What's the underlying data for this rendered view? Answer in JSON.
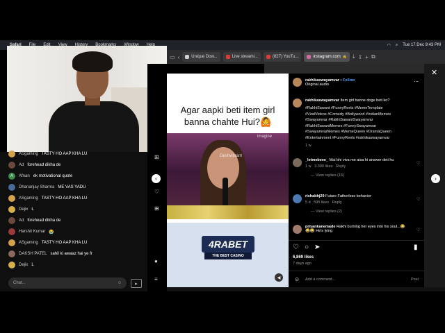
{
  "menubar": {
    "items": [
      "Safari",
      "File",
      "Edit",
      "View",
      "History",
      "Bookmarks",
      "Window",
      "Help"
    ],
    "clock": "Tue 17 Dec 9:43 PM"
  },
  "browser": {
    "tabs": [
      {
        "label": "Unique Dow...",
        "color": "#cfcfcf"
      },
      {
        "label": "Live streami...",
        "color": "#e53935"
      },
      {
        "label": "(827) YouTu...",
        "color": "#e53935"
      },
      {
        "label": "instagram.com",
        "color": "#d06aa0"
      }
    ]
  },
  "chat": {
    "messages": [
      {
        "user": "ASgaming",
        "text": "TASTY HO AAP KHA LU",
        "avatar": "#d4a24a"
      },
      {
        "user": "Ad",
        "text": "forehead dikha de",
        "avatar": "#6a4a3a"
      },
      {
        "user": "Afnan",
        "text": "ek motivational quote",
        "avatar": "#3a8a4a",
        "initial": "A"
      },
      {
        "user": "Dhananjay Sharma",
        "text": "ME VAS YADU",
        "avatar": "#4a6a9a"
      },
      {
        "user": "ASgaming",
        "text": "TASTY HO AAP KHA LU",
        "avatar": "#d4a24a"
      },
      {
        "user": "Dejix",
        "text": "L",
        "avatar": "#d4b04a"
      },
      {
        "user": "Ad",
        "text": "forehead dikha de",
        "avatar": "#6a4a3a"
      },
      {
        "user": "Harshit Kumar",
        "text": "😭",
        "avatar": "#9a3a3a"
      },
      {
        "user": "ASgaming",
        "text": "TASTY HO AAP KHA LU",
        "avatar": "#d4a24a"
      },
      {
        "user": "DAKSH PATEL",
        "text": "sahil ki awaaz hai ye fr",
        "avatar": "#8a6a5a"
      },
      {
        "user": "Dejix",
        "text": "L",
        "avatar": "#d4b04a"
      }
    ],
    "input_placeholder": "Chat..."
  },
  "video": {
    "caption": "Agar aapki beti item girl banna chahte Hui?🙆",
    "watermark1": "imagine",
    "watermark2": "Deshvibrant",
    "ad_logo": "4RABET",
    "ad_sub": "THE BEST CASINO"
  },
  "post": {
    "username": "rakhikaswayamvar",
    "follow": "Follow",
    "audio": "Original audio",
    "caption_text": "Item girl banne doge beti ko?",
    "hashtags": [
      "#RakhiSawant #FunnyReels #MemeTemplate",
      "#ViralVideos #Comedy #Bollywood #IndianMemes",
      "#Swayamvar #RakhiSawantSwayamvar",
      "#RakhiSawantMemes #FunnySwayamvar",
      "#SwayamvarMemes #MemeQueen #DramaQueen",
      "#Entertainment #FunnyReels #rakhikaswayamvar"
    ],
    "caption_age": "1 w",
    "comments": [
      {
        "user": "_letmebeee_",
        "text": "Mai bhi viva me aisa hi answer deti hu",
        "meta_age": "1 w",
        "likes": "3,300 likes",
        "reply": "Reply",
        "view_replies": "View replies (16)"
      },
      {
        "user": "rishabhj29",
        "text": "Future Fatherless behavior",
        "meta_age": "5 d",
        "likes": "595 likes",
        "reply": "Reply",
        "view_replies": "View replies (2)"
      },
      {
        "user": "priyankanemade",
        "text": "Rakhi burning her eyes into his soul...😂😂😂 He's lying"
      }
    ],
    "likes": "6,869 likes",
    "time_ago": "7 days ago",
    "add_comment": "Add a comment...",
    "post_button": "Post"
  }
}
